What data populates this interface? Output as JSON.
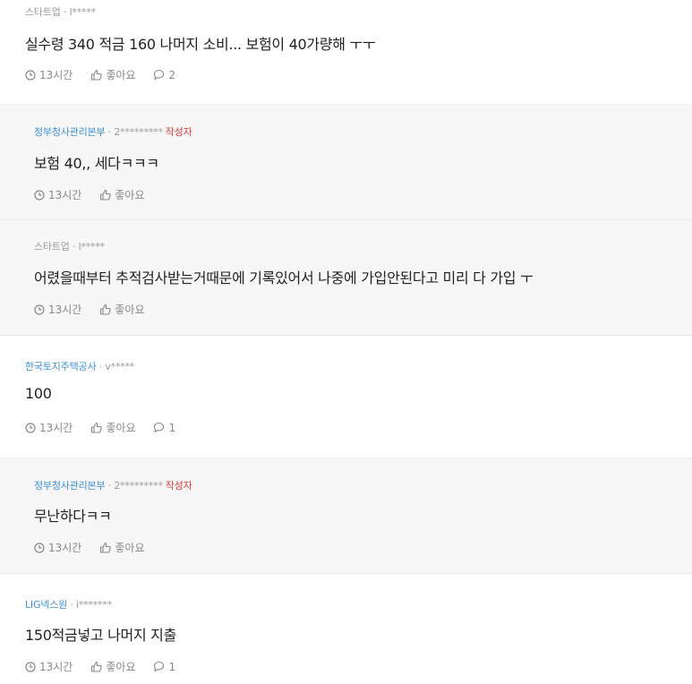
{
  "comments": [
    {
      "company": "스타트업",
      "sep": " · ",
      "user": "l*****",
      "author_badge": "",
      "text": "실수령 340 적금 160 나머지 소비... 보험이 40가량해 ㅜㅜ",
      "time": "13시간",
      "like_label": "좋아요",
      "reply_count": "2"
    },
    {
      "company": "정부청사관리본부",
      "sep": " · ",
      "user": "2*********",
      "author_badge": "작성자",
      "text": "보험 40,, 세다ㅋㅋㅋ",
      "time": "13시간",
      "like_label": "좋아요",
      "reply_count": ""
    },
    {
      "company": "스타트업",
      "sep": " · ",
      "user": "l*****",
      "author_badge": "",
      "text": "어렸을때부터 추적검사받는거때문에 기록있어서 나중에 가입안된다고 미리 다 가입 ㅜ",
      "time": "13시간",
      "like_label": "좋아요",
      "reply_count": ""
    },
    {
      "company": "한국토지주택공사",
      "sep": " · ",
      "user": "v*****",
      "author_badge": "",
      "text": "100",
      "time": "13시간",
      "like_label": "좋아요",
      "reply_count": "1"
    },
    {
      "company": "정부청사관리본부",
      "sep": " · ",
      "user": "2*********",
      "author_badge": "작성자",
      "text": "무난하다ㅋㅋ",
      "time": "13시간",
      "like_label": "좋아요",
      "reply_count": ""
    },
    {
      "company": "LIG넥스원",
      "sep": " · ",
      "user": "i*******",
      "author_badge": "",
      "text": "150적금넣고 나머지 지출",
      "time": "13시간",
      "like_label": "좋아요",
      "reply_count": "1"
    }
  ],
  "colors": {
    "company_link": "#3d8fd6",
    "author_badge": "#e03c3c",
    "reply_bg": "#f7f7f7"
  }
}
